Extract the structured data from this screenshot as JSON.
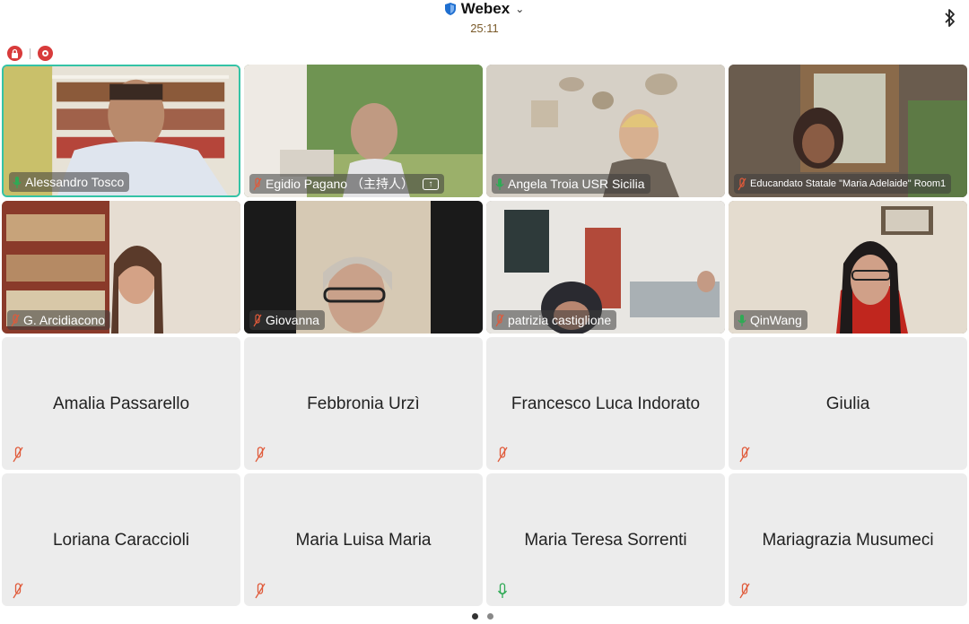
{
  "header": {
    "title": "Webex",
    "timer": "25:11"
  },
  "video_tiles": [
    {
      "name": "Alessandro Tosco",
      "mic": "on",
      "active": true
    },
    {
      "name": "Egidio Pagano （主持人）",
      "mic": "muted",
      "sharing": true
    },
    {
      "name": "Angela Troia USR Sicilia",
      "mic": "on"
    },
    {
      "name": "Educandato Statale \"Maria Adelaide\" Room1",
      "mic": "muted"
    },
    {
      "name": "G. Arcidiacono",
      "mic": "muted"
    },
    {
      "name": "Giovanna",
      "mic": "muted"
    },
    {
      "name": "patrizia castiglione",
      "mic": "muted"
    },
    {
      "name": "QinWang",
      "mic": "on"
    }
  ],
  "audio_tiles": [
    {
      "name": "Amalia Passarello",
      "mic": "muted"
    },
    {
      "name": "Febbronia Urzì",
      "mic": "muted"
    },
    {
      "name": "Francesco Luca Indorato",
      "mic": "muted"
    },
    {
      "name": "Giulia",
      "mic": "muted"
    },
    {
      "name": "Loriana Caraccioli",
      "mic": "muted"
    },
    {
      "name": "Maria Luisa Maria",
      "mic": "muted"
    },
    {
      "name": "Maria Teresa Sorrenti",
      "mic": "on"
    },
    {
      "name": "Mariagrazia Musumeci",
      "mic": "muted"
    }
  ],
  "pager": {
    "pages": 2,
    "current": 1
  },
  "colors": {
    "accent": "#34c3a6",
    "muted": "#e05a3a",
    "unmuted": "#2faa55",
    "record": "#d83b3b"
  }
}
